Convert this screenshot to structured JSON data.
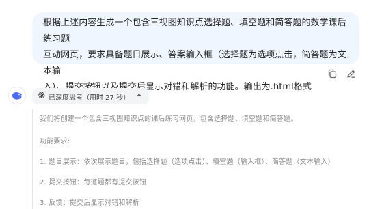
{
  "user_message": {
    "lines": [
      "根据上述内容生成一个包含三视图知识点选择题、填空题和简答题的数学课后练习题",
      "互动网页，要求具备题目展示、答案输入框（选择题为选项点击，简答题为文本输",
      "入）、提交按钮以及提交后显示对错和解析的功能。输出为.html格式"
    ],
    "actions": [
      "copy-icon",
      "edit-icon"
    ]
  },
  "assistant": {
    "avatar_icon": "deepseek-whale-icon",
    "thinking_chip": {
      "icon": "atom-icon",
      "label": "已深度思考（用时 27 秒）",
      "toggle_icon": "chevron-up-icon"
    },
    "thinking_lines": [
      "我们将创建一个包含三视图知识点的课后练习网页，包含选择题、填空题和简答题。",
      "功能要求:",
      "1. 题目展示：依次展示题目，包括选择题（选项点击）、填空题（输入框）、简答题（文本输入）",
      "2. 提交按钮：每道题都有提交按钮",
      "3. 反馈：提交后显示对错和解析"
    ]
  },
  "colors": {
    "user_bubble": "#eff6ff",
    "chip_bg": "#f3f4f6",
    "brand_blue": "#4d6bfe",
    "muted_text": "#8b8b8b"
  }
}
